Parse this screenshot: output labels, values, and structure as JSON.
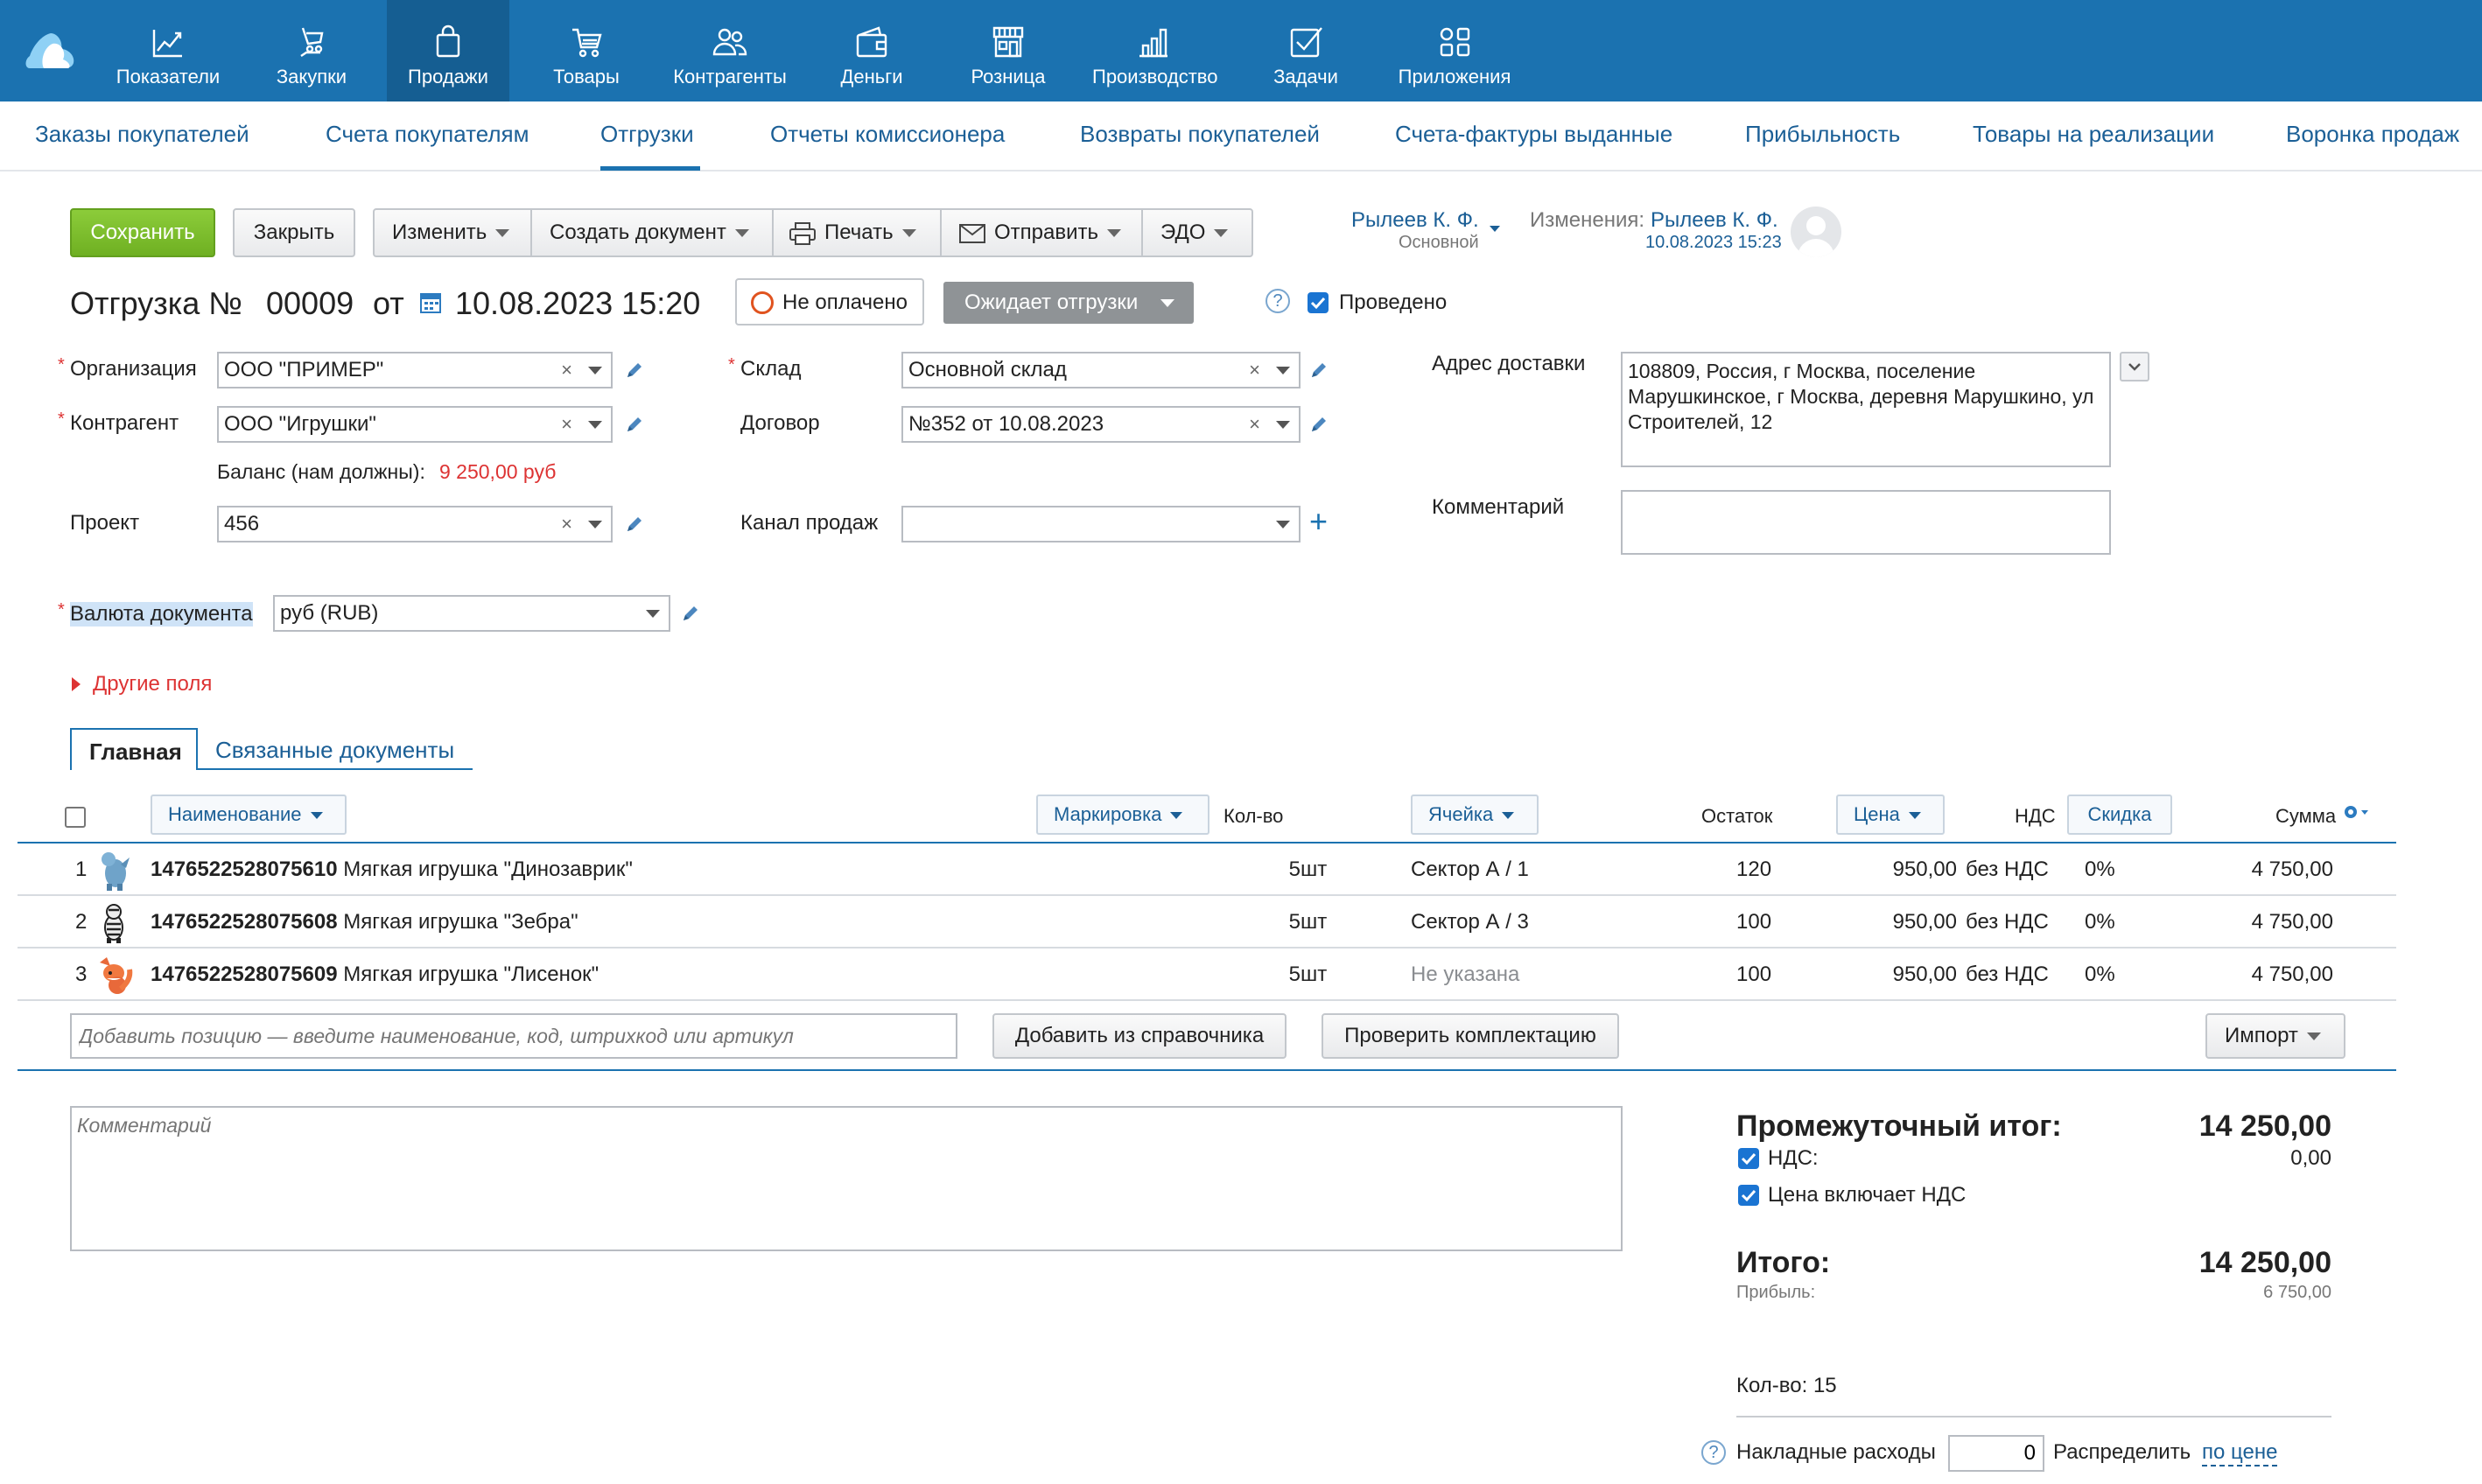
{
  "topnav": {
    "items": [
      {
        "label": "Показатели",
        "icon": "chart-line-icon"
      },
      {
        "label": "Закупки",
        "icon": "cart-hand-icon"
      },
      {
        "label": "Продажи",
        "icon": "shopping-bag-icon",
        "active": true
      },
      {
        "label": "Товары",
        "icon": "cart-icon"
      },
      {
        "label": "Контрагенты",
        "icon": "users-icon"
      },
      {
        "label": "Деньги",
        "icon": "wallet-icon"
      },
      {
        "label": "Розница",
        "icon": "store-icon"
      },
      {
        "label": "Производство",
        "icon": "factory-icon"
      },
      {
        "label": "Задачи",
        "icon": "checkbox-icon"
      },
      {
        "label": "Приложения",
        "icon": "apps-grid-icon"
      }
    ]
  },
  "subnav": {
    "items": [
      "Заказы покупателей",
      "Счета покупателям",
      "Отгрузки",
      "Отчеты комиссионера",
      "Возвраты покупателей",
      "Счета-фактуры выданные",
      "Прибыльность",
      "Товары на реализации",
      "Воронка продаж"
    ],
    "active_index": 2
  },
  "toolbar": {
    "save": "Сохранить",
    "close": "Закрыть",
    "edit": "Изменить",
    "create_doc": "Создать документ",
    "print": "Печать",
    "send": "Отправить",
    "edo": "ЭДО"
  },
  "owner": {
    "name": "Рылеев К. Ф.",
    "role": "Основной",
    "changes_label": "Изменения:",
    "changes_user": "Рылеев К. Ф.",
    "changes_date": "10.08.2023 15:23"
  },
  "document": {
    "title_prefix": "Отгрузка №",
    "number": "00009",
    "from": "от",
    "datetime": "10.08.2023 15:20",
    "payment_status": "Не оплачено",
    "shipment_status": "Ожидает отгрузки",
    "help": "?",
    "posted_label": "Проведено",
    "posted": true
  },
  "form": {
    "org_label": "Организация",
    "org_value": "ООО \"ПРИМЕР\"",
    "contractor_label": "Контрагент",
    "contractor_value": "ООО \"Игрушки\"",
    "balance_label": "Баланс (нам должны):",
    "balance_value": "9 250,00 руб",
    "project_label": "Проект",
    "project_value": "456",
    "warehouse_label": "Склад",
    "warehouse_value": "Основной склад",
    "contract_label": "Договор",
    "contract_value": "№352 от 10.08.2023",
    "channel_label": "Канал продаж",
    "channel_value": "",
    "address_label": "Адрес доставки",
    "address_value": "108809, Россия, г Москва, поселение Марушкинское, г Москва, деревня Марушкино, ул Строителей, 12",
    "comment_label": "Комментарий",
    "comment_value": "",
    "currency_label": "Валюта документа",
    "currency_value": "руб (RUB)",
    "other_fields": "Другие поля",
    "clear": "×"
  },
  "tabs": {
    "main": "Главная",
    "related": "Связанные документы"
  },
  "table": {
    "headers": {
      "name": "Наименование",
      "marking": "Маркировка",
      "qty": "Кол-во",
      "cell": "Ячейка",
      "stock": "Остаток",
      "price": "Цена",
      "vat": "НДС",
      "discount": "Скидка",
      "sum": "Сумма"
    },
    "rows": [
      {
        "n": "1",
        "code": "1476522528075610",
        "name": "Мягкая игрушка \"Динозаврик\"",
        "qty": "5",
        "unit": "шт",
        "cell": "Сектор А / 1",
        "stock": "120",
        "price": "950,00",
        "vat": "без НДС",
        "discount": "0%",
        "sum": "4 750,00",
        "thumb": "dinosaur-toy",
        "cell_unset": false
      },
      {
        "n": "2",
        "code": "1476522528075608",
        "name": "Мягкая игрушка \"Зебра\"",
        "qty": "5",
        "unit": "шт",
        "cell": "Сектор А / 3",
        "stock": "100",
        "price": "950,00",
        "vat": "без НДС",
        "discount": "0%",
        "sum": "4 750,00",
        "thumb": "zebra-toy",
        "cell_unset": false
      },
      {
        "n": "3",
        "code": "1476522528075609",
        "name": "Мягкая игрушка \"Лисенок\"",
        "qty": "5",
        "unit": "шт",
        "cell": "Не указана",
        "stock": "100",
        "price": "950,00",
        "vat": "без НДС",
        "discount": "0%",
        "sum": "4 750,00",
        "thumb": "fox-toy",
        "cell_unset": true
      }
    ],
    "add_placeholder": "Добавить позицию — введите наименование, код, штрихкод или артикул",
    "add_from_catalog": "Добавить из справочника",
    "check_kit": "Проверить комплектацию",
    "import": "Импорт"
  },
  "footer": {
    "comment_placeholder": "Комментарий",
    "subtotal_label": "Промежуточный итог:",
    "subtotal_value": "14 250,00",
    "vat_label": "НДС:",
    "vat_value": "0,00",
    "price_incl_vat_label": "Цена включает НДС",
    "total_label": "Итого:",
    "total_value": "14 250,00",
    "profit_label": "Прибыль:",
    "profit_value": "6 750,00",
    "qty_total": "Кол-во: 15",
    "overhead_label": "Накладные расходы",
    "overhead_value": "0",
    "distribute_label": "Распределить",
    "distribute_mode": "по цене",
    "help": "?"
  },
  "colors": {
    "topbar": "#1b72b0",
    "active_nav": "#155e92",
    "link": "#1b5f96",
    "save_green": "#7dbf2e",
    "required_red": "#dd3333",
    "balance_red": "#dd3333"
  }
}
